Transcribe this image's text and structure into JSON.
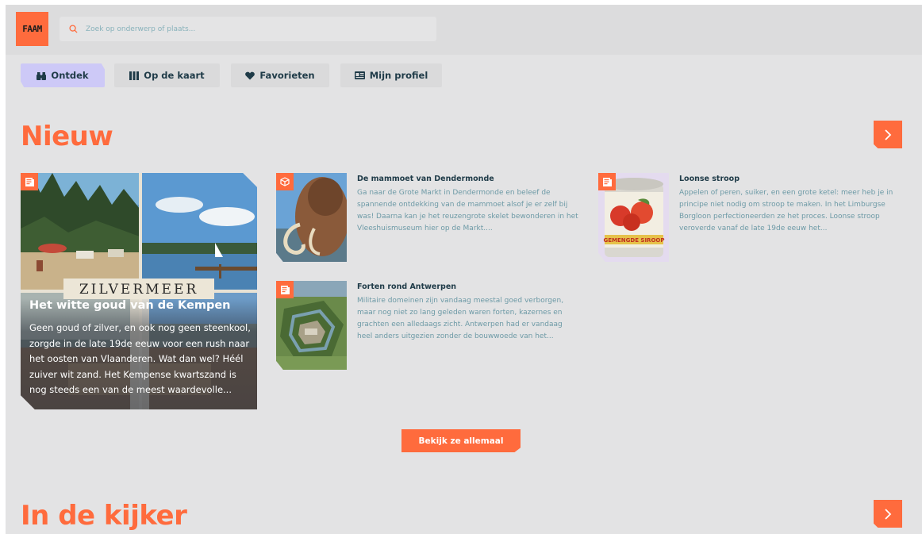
{
  "header": {
    "logo_text": "FAAM",
    "search_placeholder": "Zoek op onderwerp of plaats..."
  },
  "tabs": [
    {
      "label": "Ontdek",
      "icon": "binoculars-icon",
      "active": true
    },
    {
      "label": "Op de kaart",
      "icon": "map-icon",
      "active": false
    },
    {
      "label": "Favorieten",
      "icon": "heart-icon",
      "active": false
    },
    {
      "label": "Mijn profiel",
      "icon": "id-card-icon",
      "active": false
    }
  ],
  "sections": {
    "nieuw": {
      "title": "Nieuw"
    },
    "in_de_kijker": {
      "title": "In de kijker"
    }
  },
  "feature": {
    "image_sign_text": "ZILVERMEER",
    "title": "Het witte goud van de Kempen",
    "text": "Geen goud of zilver, en ook nog geen steenkool, zorgde in de late 19de eeuw voor een rush naar het oosten van Vlaanderen. Wat dan wel? Héél zuiver wit zand. Het Kempense kwartszand is nog steeds een van de meest waardevolle...",
    "badge_icon": "article-icon"
  },
  "cards": [
    {
      "title": "De mammoet van Dendermonde",
      "text": "Ga naar de Grote Markt in Dendermonde en beleef de spannende ontdekking van de mammoet alsof je er zelf bij was! Daarna kan je het reuzengrote skelet bewonderen in het Vleeshuismuseum hier op de Markt....",
      "badge_icon": "ar-cube-icon"
    },
    {
      "title": "Loonse stroop",
      "text": "Appelen of peren, suiker, en een grote ketel: meer heb je in principe niet nodig om stroop te maken. In het Limburgse Borgloon perfectioneerden ze het proces. Loonse stroop veroverde vanaf de late 19de eeuw het...",
      "badge_icon": "article-icon",
      "image_label": "GEMENGDE SIROOP"
    },
    {
      "title": "Forten rond Antwerpen",
      "text": "Militaire domeinen zijn vandaag meestal goed verborgen, maar nog niet zo lang geleden waren forten, kazernes en grachten een alledaags zicht. Antwerpen had er vandaag heel anders uitgezien zonder de bouwwoede van het...",
      "badge_icon": "article-icon"
    }
  ],
  "more_button": {
    "label": "Bekijk ze allemaal"
  },
  "colors": {
    "accent": "#ff6b3d",
    "active_tab": "#cdc9f7",
    "title_text": "#1f3b48",
    "body_text": "#6d9aa6",
    "background": "#e3e3e4"
  }
}
